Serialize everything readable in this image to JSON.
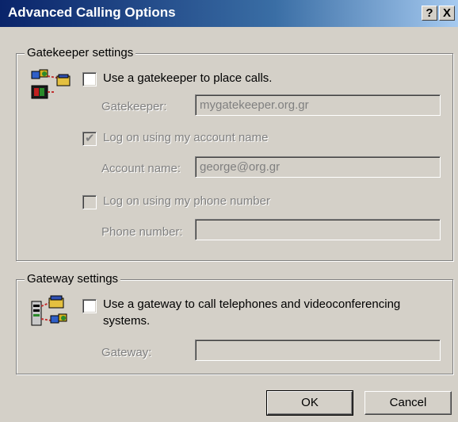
{
  "window": {
    "title": "Advanced Calling Options",
    "help_label": "?",
    "close_label": "X"
  },
  "gatekeeper": {
    "legend": "Gatekeeper settings",
    "use_gatekeeper": {
      "label": "Use a gatekeeper to place calls.",
      "checked": false
    },
    "gatekeeper_field": {
      "label": "Gatekeeper:",
      "value": "mygatekeeper.org.gr"
    },
    "log_on_account": {
      "label": "Log on using my account name",
      "checked": true
    },
    "account_field": {
      "label": "Account name:",
      "value": "george@org.gr"
    },
    "log_on_phone": {
      "label": "Log on using my phone number",
      "checked": false
    },
    "phone_field": {
      "label": "Phone number:",
      "value": ""
    }
  },
  "gateway": {
    "legend": "Gateway settings",
    "use_gateway": {
      "label": "Use a gateway to call telephones and videoconferencing",
      "label_line2": "systems.",
      "checked": false
    },
    "gateway_field": {
      "label": "Gateway:",
      "value": ""
    }
  },
  "buttons": {
    "ok": "OK",
    "cancel": "Cancel"
  },
  "icons": {
    "gatekeeper": "network-phone-icon",
    "gateway": "phone-gateway-icon"
  }
}
